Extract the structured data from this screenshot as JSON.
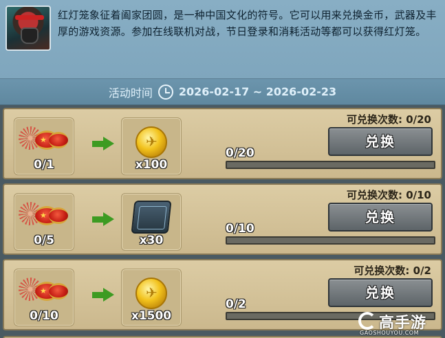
{
  "header": {
    "description": "红灯笼象征着阖家团圆，是一种中国文化的符号。它可以用来兑换金币，武器及丰厚的游戏资源。参加在线联机对战，节日登录和消耗活动等都可以获得红灯笼。",
    "avatar_icon": "soldier-avatar-icon"
  },
  "event_time": {
    "label": "活动时间",
    "range": "2026-02-17 ~ 2026-02-23",
    "icon": "clock-icon"
  },
  "exchange_rows": [
    {
      "source_qty": "0/1",
      "source_icon": "red-lantern-icon",
      "reward_icon": "gold-coin-icon",
      "reward_qty": "x100",
      "limit_text": "可兑换次数: 0/20",
      "progress_text": "0/20",
      "progress_fraction": 0,
      "button_label": "兑换"
    },
    {
      "source_qty": "0/5",
      "source_icon": "red-lantern-icon",
      "reward_icon": "chip-icon",
      "reward_qty": "x30",
      "limit_text": "可兑换次数: 0/10",
      "progress_text": "0/10",
      "progress_fraction": 0,
      "button_label": "兑换"
    },
    {
      "source_qty": "0/10",
      "source_icon": "red-lantern-icon",
      "reward_icon": "gold-coin-icon",
      "reward_qty": "x1500",
      "limit_text": "可兑换次数: 0/2",
      "progress_text": "0/2",
      "progress_fraction": 0,
      "button_label": "兑换"
    }
  ],
  "watermark": {
    "brand": "高手游",
    "domain": "GAOSHOUYOU.COM"
  },
  "colors": {
    "header_bg": "#88aec4",
    "row_bg": "#dccca4",
    "arrow_green": "#3d9b22",
    "button_gray": "#6f7579"
  }
}
